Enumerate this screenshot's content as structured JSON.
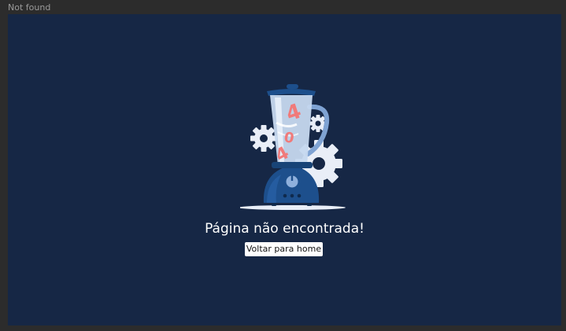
{
  "window": {
    "title": "Not found"
  },
  "colors": {
    "page_background": "#162745",
    "frame_background": "#2c2c2c",
    "blender_base": "#1d4f8c",
    "jar": "#b9d0ee",
    "gears": "#e9eef7",
    "letters": "#f07a7a"
  },
  "illustration": {
    "icon": "blender-with-gears-icon",
    "letters": "404"
  },
  "main": {
    "heading": "Página não encontrada!",
    "home_button_label": "Voltar para home"
  }
}
